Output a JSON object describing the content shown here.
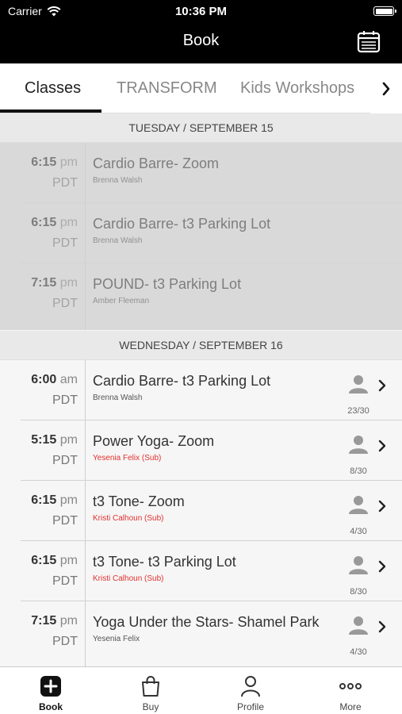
{
  "status_bar": {
    "carrier": "Carrier",
    "time": "10:36 PM"
  },
  "header": {
    "title": "Book",
    "calendar_icon": "calendar-icon"
  },
  "tabs": [
    {
      "label": "Classes",
      "active": true
    },
    {
      "label": "TRANSFORM",
      "active": false
    },
    {
      "label": "Kids Workshops",
      "active": false
    }
  ],
  "days": [
    {
      "label": "TUESDAY / SEPTEMBER 15",
      "past": true,
      "classes": [
        {
          "time": "6:15",
          "ampm": "pm",
          "tz": "PDT",
          "name": "Cardio Barre- Zoom",
          "instructor": "Brenna Walsh",
          "sub": false
        },
        {
          "time": "6:15",
          "ampm": "pm",
          "tz": "PDT",
          "name": "Cardio Barre- t3 Parking Lot",
          "instructor": "Brenna Walsh",
          "sub": false
        },
        {
          "time": "7:15",
          "ampm": "pm",
          "tz": "PDT",
          "name": "POUND- t3 Parking Lot",
          "instructor": "Amber Fleeman",
          "sub": false
        }
      ]
    },
    {
      "label": "WEDNESDAY / SEPTEMBER 16",
      "past": false,
      "classes": [
        {
          "time": "6:00",
          "ampm": "am",
          "tz": "PDT",
          "name": "Cardio Barre- t3 Parking Lot",
          "instructor": "Brenna Walsh",
          "sub": false,
          "capacity": "23/30"
        },
        {
          "time": "5:15",
          "ampm": "pm",
          "tz": "PDT",
          "name": "Power Yoga- Zoom",
          "instructor": "Yesenia Felix (Sub)",
          "sub": true,
          "capacity": "8/30"
        },
        {
          "time": "6:15",
          "ampm": "pm",
          "tz": "PDT",
          "name": "t3 Tone- Zoom",
          "instructor": "Kristi Calhoun (Sub)",
          "sub": true,
          "capacity": "4/30"
        },
        {
          "time": "6:15",
          "ampm": "pm",
          "tz": "PDT",
          "name": "t3 Tone- t3 Parking Lot",
          "instructor": "Kristi Calhoun (Sub)",
          "sub": true,
          "capacity": "8/30"
        },
        {
          "time": "7:15",
          "ampm": "pm",
          "tz": "PDT",
          "name": "Yoga Under the Stars- Shamel Park",
          "instructor": "Yesenia Felix",
          "sub": false,
          "capacity": "4/30"
        }
      ]
    }
  ],
  "bottom_nav": [
    {
      "label": "Book",
      "icon": "book-plus-icon",
      "active": true
    },
    {
      "label": "Buy",
      "icon": "shopping-bag-icon",
      "active": false
    },
    {
      "label": "Profile",
      "icon": "person-icon",
      "active": false
    },
    {
      "label": "More",
      "icon": "more-dots-icon",
      "active": false
    }
  ],
  "colors": {
    "sub_instructor": "#e23030",
    "header_bg": "#000000"
  }
}
